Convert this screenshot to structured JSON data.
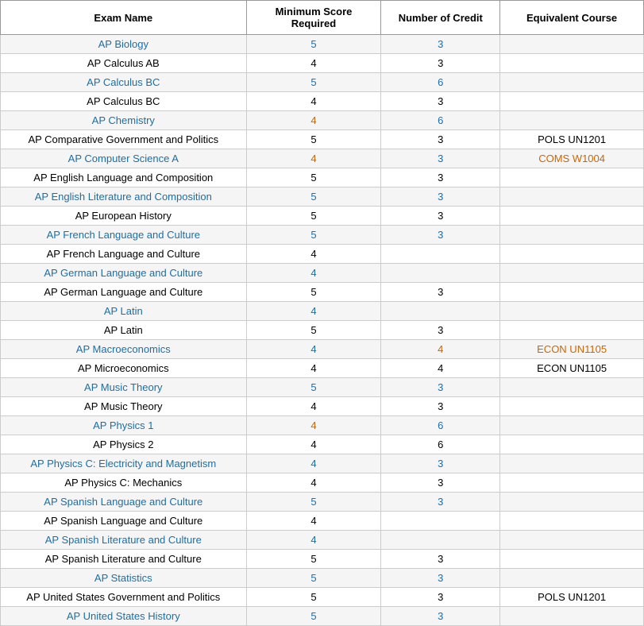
{
  "table": {
    "headers": [
      "Exam Name",
      "Minimum Score Required",
      "Number of Credit",
      "Equivalent Course"
    ],
    "rows": [
      {
        "name": "AP Biology",
        "nameColor": "blue",
        "minScore": "5",
        "minColor": "blue",
        "numCredit": "3",
        "numColor": "blue",
        "equiv": "",
        "equivColor": ""
      },
      {
        "name": "AP Calculus AB",
        "nameColor": "",
        "minScore": "4",
        "minColor": "",
        "numCredit": "3",
        "numColor": "",
        "equiv": "",
        "equivColor": ""
      },
      {
        "name": "AP Calculus BC",
        "nameColor": "blue",
        "minScore": "5",
        "minColor": "blue",
        "numCredit": "6",
        "numColor": "blue",
        "equiv": "",
        "equivColor": ""
      },
      {
        "name": "AP Calculus BC",
        "nameColor": "",
        "minScore": "4",
        "minColor": "",
        "numCredit": "3",
        "numColor": "",
        "equiv": "",
        "equivColor": ""
      },
      {
        "name": "AP Chemistry",
        "nameColor": "blue",
        "minScore": "4",
        "minColor": "orange",
        "numCredit": "6",
        "numColor": "blue",
        "equiv": "",
        "equivColor": ""
      },
      {
        "name": "AP Comparative Government and Politics",
        "nameColor": "",
        "minScore": "5",
        "minColor": "",
        "numCredit": "3",
        "numColor": "",
        "equiv": "POLS UN1201",
        "equivColor": ""
      },
      {
        "name": "AP Computer Science A",
        "nameColor": "blue",
        "minScore": "4",
        "minColor": "orange",
        "numCredit": "3",
        "numColor": "blue",
        "equiv": "COMS W1004",
        "equivColor": "orange"
      },
      {
        "name": "AP English Language and Composition",
        "nameColor": "",
        "minScore": "5",
        "minColor": "",
        "numCredit": "3",
        "numColor": "",
        "equiv": "",
        "equivColor": ""
      },
      {
        "name": "AP English Literature and Composition",
        "nameColor": "blue",
        "minScore": "5",
        "minColor": "blue",
        "numCredit": "3",
        "numColor": "blue",
        "equiv": "",
        "equivColor": ""
      },
      {
        "name": "AP European History",
        "nameColor": "",
        "minScore": "5",
        "minColor": "",
        "numCredit": "3",
        "numColor": "",
        "equiv": "",
        "equivColor": ""
      },
      {
        "name": "AP French Language and Culture",
        "nameColor": "blue",
        "minScore": "5",
        "minColor": "blue",
        "numCredit": "3",
        "numColor": "blue",
        "equiv": "",
        "equivColor": ""
      },
      {
        "name": "AP French Language and Culture",
        "nameColor": "",
        "minScore": "4",
        "minColor": "",
        "numCredit": "",
        "numColor": "",
        "equiv": "",
        "equivColor": ""
      },
      {
        "name": "AP German Language and Culture",
        "nameColor": "blue",
        "minScore": "4",
        "minColor": "blue",
        "numCredit": "",
        "numColor": "",
        "equiv": "",
        "equivColor": ""
      },
      {
        "name": "AP German Language and Culture",
        "nameColor": "",
        "minScore": "5",
        "minColor": "",
        "numCredit": "3",
        "numColor": "",
        "equiv": "",
        "equivColor": ""
      },
      {
        "name": "AP Latin",
        "nameColor": "blue",
        "minScore": "4",
        "minColor": "blue",
        "numCredit": "",
        "numColor": "",
        "equiv": "",
        "equivColor": ""
      },
      {
        "name": "AP Latin",
        "nameColor": "",
        "minScore": "5",
        "minColor": "",
        "numCredit": "3",
        "numColor": "",
        "equiv": "",
        "equivColor": ""
      },
      {
        "name": "AP Macroeconomics",
        "nameColor": "blue",
        "minScore": "4",
        "minColor": "blue",
        "numCredit": "4",
        "numColor": "orange",
        "equiv": "ECON UN1105",
        "equivColor": "orange"
      },
      {
        "name": "AP Microeconomics",
        "nameColor": "",
        "minScore": "4",
        "minColor": "",
        "numCredit": "4",
        "numColor": "",
        "equiv": "ECON UN1105",
        "equivColor": ""
      },
      {
        "name": "AP Music Theory",
        "nameColor": "blue",
        "minScore": "5",
        "minColor": "blue",
        "numCredit": "3",
        "numColor": "blue",
        "equiv": "",
        "equivColor": ""
      },
      {
        "name": "AP Music Theory",
        "nameColor": "",
        "minScore": "4",
        "minColor": "",
        "numCredit": "3",
        "numColor": "",
        "equiv": "",
        "equivColor": ""
      },
      {
        "name": "AP Physics 1",
        "nameColor": "blue",
        "minScore": "4",
        "minColor": "orange",
        "numCredit": "6",
        "numColor": "blue",
        "equiv": "",
        "equivColor": ""
      },
      {
        "name": "AP Physics 2",
        "nameColor": "",
        "minScore": "4",
        "minColor": "",
        "numCredit": "6",
        "numColor": "",
        "equiv": "",
        "equivColor": ""
      },
      {
        "name": "AP Physics C: Electricity and Magnetism",
        "nameColor": "blue",
        "minScore": "4",
        "minColor": "blue",
        "numCredit": "3",
        "numColor": "blue",
        "equiv": "",
        "equivColor": ""
      },
      {
        "name": "AP Physics C: Mechanics",
        "nameColor": "",
        "minScore": "4",
        "minColor": "",
        "numCredit": "3",
        "numColor": "",
        "equiv": "",
        "equivColor": ""
      },
      {
        "name": "AP Spanish Language and Culture",
        "nameColor": "blue",
        "minScore": "5",
        "minColor": "blue",
        "numCredit": "3",
        "numColor": "blue",
        "equiv": "",
        "equivColor": ""
      },
      {
        "name": "AP Spanish Language and Culture",
        "nameColor": "",
        "minScore": "4",
        "minColor": "",
        "numCredit": "",
        "numColor": "",
        "equiv": "",
        "equivColor": ""
      },
      {
        "name": "AP Spanish Literature and Culture",
        "nameColor": "blue",
        "minScore": "4",
        "minColor": "blue",
        "numCredit": "",
        "numColor": "",
        "equiv": "",
        "equivColor": ""
      },
      {
        "name": "AP Spanish Literature and Culture",
        "nameColor": "",
        "minScore": "5",
        "minColor": "",
        "numCredit": "3",
        "numColor": "",
        "equiv": "",
        "equivColor": ""
      },
      {
        "name": "AP Statistics",
        "nameColor": "blue",
        "minScore": "5",
        "minColor": "blue",
        "numCredit": "3",
        "numColor": "blue",
        "equiv": "",
        "equivColor": ""
      },
      {
        "name": "AP United States Government and Politics",
        "nameColor": "",
        "minScore": "5",
        "minColor": "",
        "numCredit": "3",
        "numColor": "",
        "equiv": "POLS UN1201",
        "equivColor": ""
      },
      {
        "name": "AP United States History",
        "nameColor": "blue",
        "minScore": "5",
        "minColor": "blue",
        "numCredit": "3",
        "numColor": "blue",
        "equiv": "",
        "equivColor": ""
      }
    ]
  }
}
